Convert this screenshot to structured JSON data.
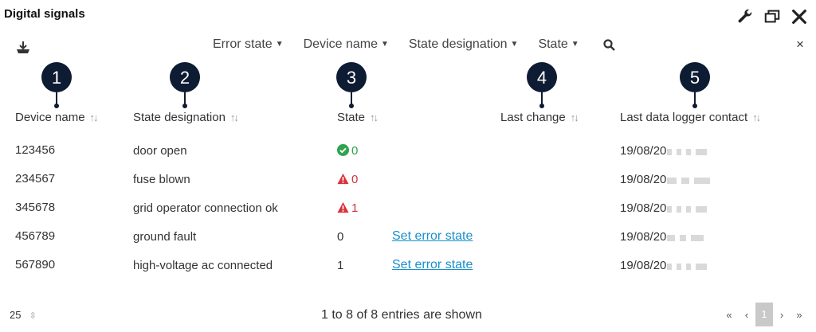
{
  "window": {
    "title": "Digital signals"
  },
  "toolbar": {
    "filters": [
      {
        "label": "Error state"
      },
      {
        "label": "Device name"
      },
      {
        "label": "State designation"
      },
      {
        "label": "State"
      }
    ],
    "close_label": "×"
  },
  "markers": [
    "1",
    "2",
    "3",
    "4",
    "5"
  ],
  "columns": {
    "device_name": "Device name",
    "state_designation": "State designation",
    "state": "State",
    "last_change": "Last change",
    "last_contact": "Last data logger contact"
  },
  "rows": [
    {
      "device": "123456",
      "designation": "door open",
      "state": "0",
      "state_kind": "ok",
      "action": "",
      "contact": "19/08/20"
    },
    {
      "device": "234567",
      "designation": "fuse blown",
      "state": "0",
      "state_kind": "error",
      "action": "",
      "contact": "19/08/20"
    },
    {
      "device": "345678",
      "designation": "grid operator connection ok",
      "state": "1",
      "state_kind": "error",
      "action": "",
      "contact": "19/08/20"
    },
    {
      "device": "456789",
      "designation": "ground fault",
      "state": "0",
      "state_kind": "plain",
      "action": "Set error state",
      "contact": "19/08/20"
    },
    {
      "device": "567890",
      "designation": "high-voltage ac connected",
      "state": "1",
      "state_kind": "plain",
      "action": "Set error state",
      "contact": "19/08/20"
    }
  ],
  "footer": {
    "page_size": "25",
    "info": "1 to 8 of 8 entries are shown",
    "pager": {
      "first": "«",
      "prev": "‹",
      "current": "1",
      "next": "›",
      "last": "»"
    }
  },
  "colors": {
    "ok": "#2ea44f",
    "error": "#d9323a",
    "link": "#1a8fc9",
    "marker": "#0d1b33"
  }
}
